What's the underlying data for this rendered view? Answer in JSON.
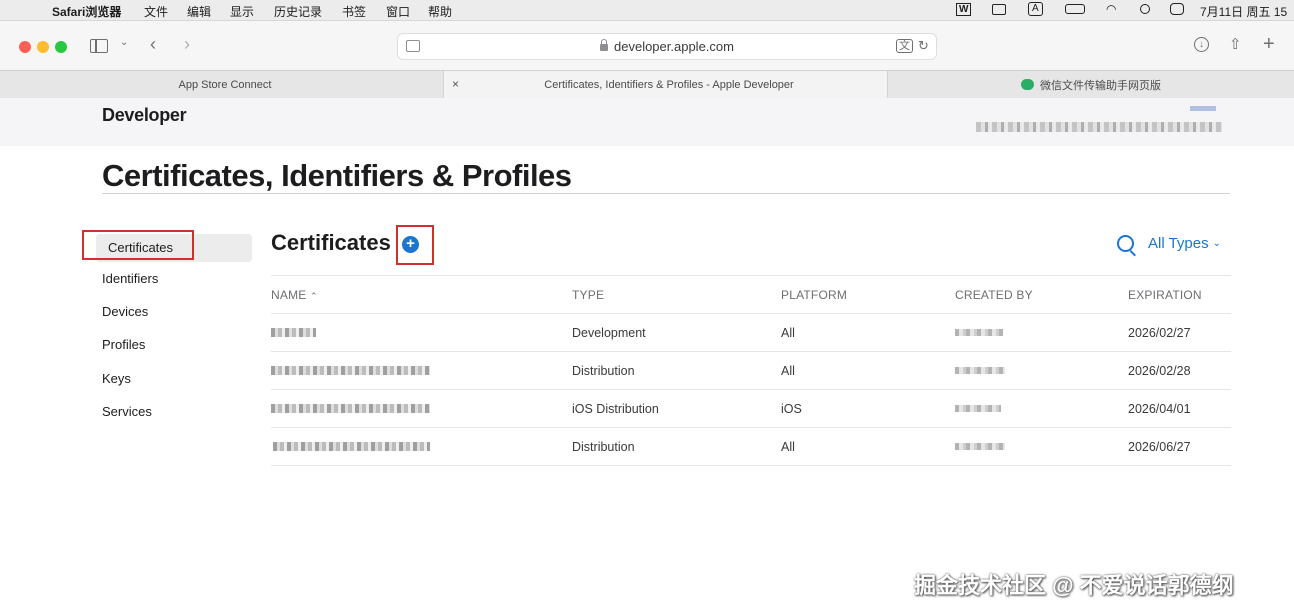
{
  "menubar": {
    "app_name": "Safari浏览器",
    "items": [
      "文件",
      "编辑",
      "显示",
      "历史记录",
      "书签",
      "窗口",
      "帮助"
    ],
    "clock": "7月11日 周五 15"
  },
  "browser": {
    "url": "developer.apple.com",
    "tabs": [
      {
        "label": "App Store Connect"
      },
      {
        "label": "Certificates, Identifiers & Profiles - Apple Developer"
      },
      {
        "label": "微信文件传输助手网页版"
      }
    ]
  },
  "header": {
    "logo_text": "Developer"
  },
  "page": {
    "title": "Certificates, Identifiers & Profiles"
  },
  "sidenav": {
    "items": [
      {
        "label": "Certificates",
        "active": true
      },
      {
        "label": "Identifiers"
      },
      {
        "label": "Devices"
      },
      {
        "label": "Profiles"
      },
      {
        "label": "Keys"
      },
      {
        "label": "Services"
      }
    ]
  },
  "content": {
    "section_title": "Certificates",
    "add_symbol": "+",
    "filter_label": "All Types",
    "filter_chevron": "⌄"
  },
  "table": {
    "headers": {
      "name": "NAME",
      "name_sort": "⌃",
      "type": "TYPE",
      "platform": "PLATFORM",
      "created_by": "CREATED BY",
      "expiration": "EXPIRATION"
    },
    "rows": [
      {
        "type": "Development",
        "platform": "All",
        "expiration": "2026/02/27"
      },
      {
        "type": "Distribution",
        "platform": "All",
        "expiration": "2026/02/28"
      },
      {
        "type": "iOS Distribution",
        "platform": "iOS",
        "expiration": "2026/04/01"
      },
      {
        "type": "Distribution",
        "platform": "All",
        "expiration": "2026/06/27"
      }
    ]
  },
  "watermark": "掘金技术社区 @ 不爱说话郭德纲",
  "colors": {
    "accent": "#1a76d2",
    "highlight_box": "#d22f2f"
  }
}
